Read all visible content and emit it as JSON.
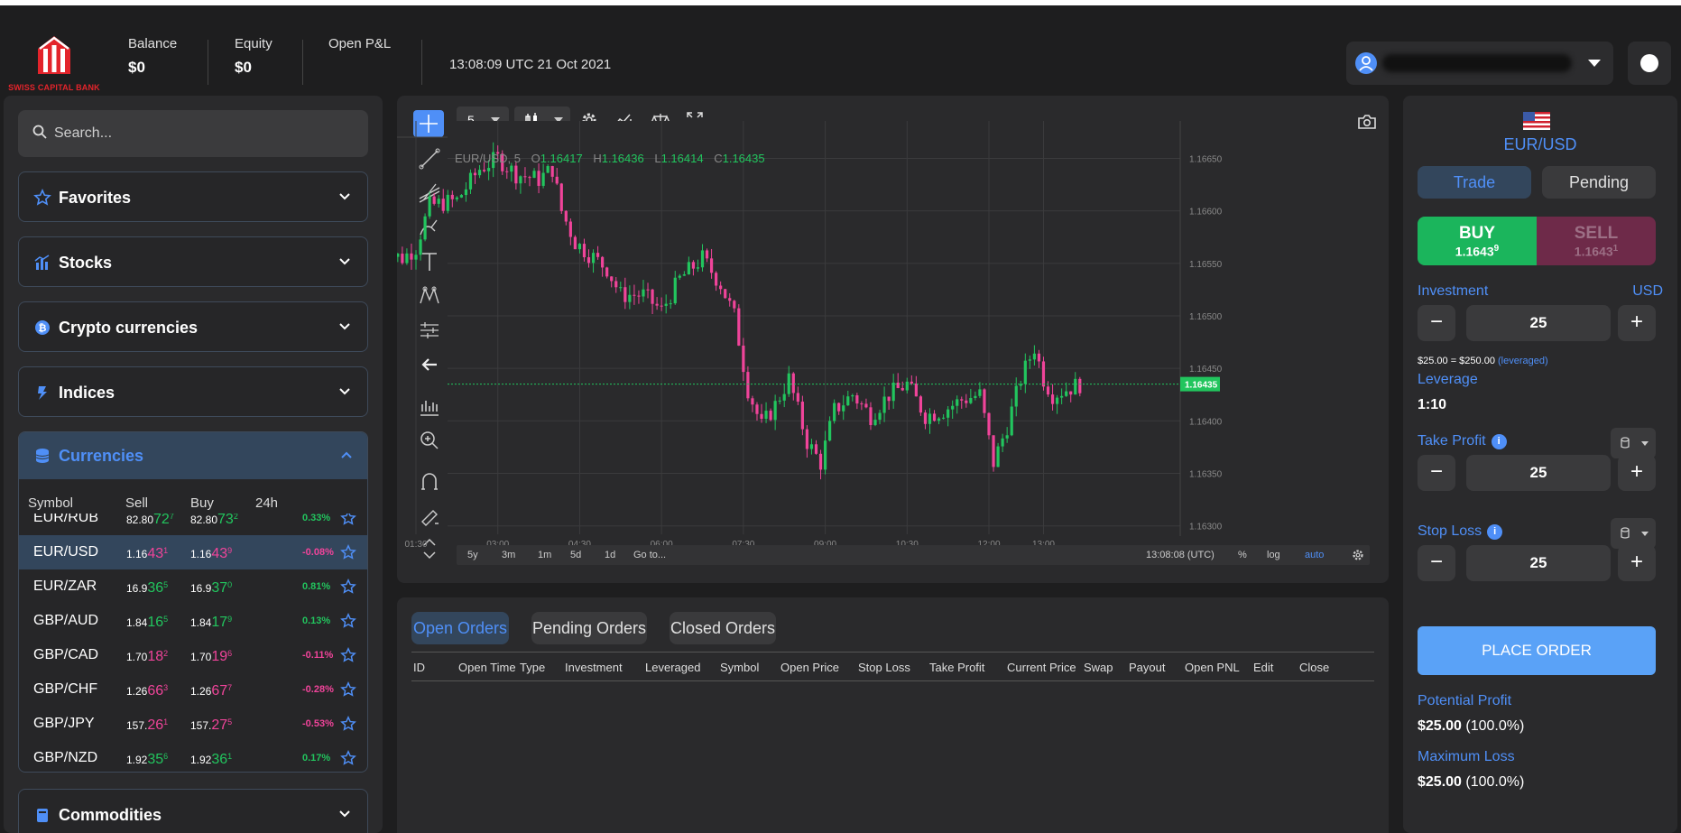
{
  "brand": {
    "name": "SWISS CAPITAL BANK"
  },
  "header": {
    "balance_label": "Balance",
    "balance_value": "$0",
    "equity_label": "Equity",
    "equity_value": "$0",
    "pnl_label": "Open P&L",
    "clock": "13:08:09 UTC 21 Oct 2021"
  },
  "sidebar": {
    "search_placeholder": "Search...",
    "categories": [
      {
        "label": "Favorites",
        "icon": "star-icon"
      },
      {
        "label": "Stocks",
        "icon": "bar-chart-icon"
      },
      {
        "label": "Crypto currencies",
        "icon": "bitcoin-icon"
      },
      {
        "label": "Indices",
        "icon": "indices-icon"
      },
      {
        "label": "Currencies",
        "icon": "coins-icon"
      },
      {
        "label": "Commodities",
        "icon": "oil-icon"
      }
    ],
    "columns": {
      "symbol": "Symbol",
      "sell": "Sell",
      "buy": "Buy",
      "change": "24h"
    },
    "rows": [
      {
        "symbol": "EUR/RUB",
        "sell_a": "82.80",
        "sell_b": "72",
        "sell_c": "7",
        "buy_a": "82.80",
        "buy_b": "73",
        "buy_c": "2",
        "change": "0.33%",
        "dir": "up"
      },
      {
        "symbol": "EUR/USD",
        "sell_a": "1.16",
        "sell_b": "43",
        "sell_c": "1",
        "buy_a": "1.16",
        "buy_b": "43",
        "buy_c": "9",
        "change": "-0.08%",
        "dir": "down"
      },
      {
        "symbol": "EUR/ZAR",
        "sell_a": "16.9",
        "sell_b": "36",
        "sell_c": "5",
        "buy_a": "16.9",
        "buy_b": "37",
        "buy_c": "0",
        "change": "0.81%",
        "dir": "up"
      },
      {
        "symbol": "GBP/AUD",
        "sell_a": "1.84",
        "sell_b": "16",
        "sell_c": "5",
        "buy_a": "1.84",
        "buy_b": "17",
        "buy_c": "9",
        "change": "0.13%",
        "dir": "up"
      },
      {
        "symbol": "GBP/CAD",
        "sell_a": "1.70",
        "sell_b": "18",
        "sell_c": "2",
        "buy_a": "1.70",
        "buy_b": "19",
        "buy_c": "6",
        "change": "-0.11%",
        "dir": "down"
      },
      {
        "symbol": "GBP/CHF",
        "sell_a": "1.26",
        "sell_b": "66",
        "sell_c": "3",
        "buy_a": "1.26",
        "buy_b": "67",
        "buy_c": "7",
        "change": "-0.28%",
        "dir": "down"
      },
      {
        "symbol": "GBP/JPY",
        "sell_a": "157.",
        "sell_b": "26",
        "sell_c": "1",
        "buy_a": "157.",
        "buy_b": "27",
        "buy_c": "5",
        "change": "-0.53%",
        "dir": "down"
      },
      {
        "symbol": "GBP/NZD",
        "sell_a": "1.92",
        "sell_b": "35",
        "sell_c": "6",
        "buy_a": "1.92",
        "buy_b": "36",
        "buy_c": "1",
        "change": "0.17%",
        "dir": "up"
      }
    ]
  },
  "chart": {
    "interval": "5",
    "series_label": "EUR/USD, 5",
    "ohlc": {
      "o_label": "O",
      "o": "1.16417",
      "h_label": "H",
      "h": "1.16436",
      "l_label": "L",
      "l": "1.16414",
      "c_label": "C",
      "c": "1.16435"
    },
    "last_price": "1.16435",
    "ranges": [
      "5y",
      "3m",
      "1m",
      "5d",
      "1d",
      "Go to..."
    ],
    "time_readout": "13:08:08 (UTC)",
    "scale_options": [
      "%",
      "log",
      "auto"
    ],
    "colors": {
      "up": "#22c55e",
      "down": "#f0449a",
      "accent": "#4f8ff7"
    }
  },
  "chart_data": {
    "type": "candlestick",
    "title": "EUR/USD, 5",
    "x_ticks": [
      "01:30",
      "03:00",
      "04:30",
      "06:00",
      "07:30",
      "09:00",
      "10:30",
      "12:00",
      "13:00"
    ],
    "y_ticks": [
      "1.16650",
      "1.16600",
      "1.16550",
      "1.16500",
      "1.16450",
      "1.16400",
      "1.16350",
      "1.16300"
    ],
    "ylim": [
      1.16292,
      1.16665
    ],
    "close_path": [
      [
        "00:50",
        1.16562
      ],
      [
        "01:15",
        1.16555
      ],
      [
        "01:30",
        1.16565
      ],
      [
        "01:45",
        1.16605
      ],
      [
        "02:15",
        1.1661
      ],
      [
        "02:40",
        1.1664
      ],
      [
        "03:00",
        1.1665
      ],
      [
        "03:20",
        1.16635
      ],
      [
        "03:45",
        1.1663
      ],
      [
        "04:00",
        1.1664
      ],
      [
        "04:10",
        1.166
      ],
      [
        "04:25",
        1.1657
      ],
      [
        "05:00",
        1.16545
      ],
      [
        "05:15",
        1.1652
      ],
      [
        "05:40",
        1.1652
      ],
      [
        "06:00",
        1.16505
      ],
      [
        "06:20",
        1.16535
      ],
      [
        "06:45",
        1.16555
      ],
      [
        "07:05",
        1.1653
      ],
      [
        "07:20",
        1.165
      ],
      [
        "07:35",
        1.1643
      ],
      [
        "07:50",
        1.16395
      ],
      [
        "08:05",
        1.16415
      ],
      [
        "08:20",
        1.1644
      ],
      [
        "08:40",
        1.1638
      ],
      [
        "08:55",
        1.1636
      ],
      [
        "09:10",
        1.1641
      ],
      [
        "09:30",
        1.16425
      ],
      [
        "09:50",
        1.16405
      ],
      [
        "10:10",
        1.16425
      ],
      [
        "10:30",
        1.16435
      ],
      [
        "10:50",
        1.16405
      ],
      [
        "11:10",
        1.1641
      ],
      [
        "11:30",
        1.1642
      ],
      [
        "11:50",
        1.16425
      ],
      [
        "12:05",
        1.1636
      ],
      [
        "12:20",
        1.16395
      ],
      [
        "12:35",
        1.1644
      ],
      [
        "12:50",
        1.1647
      ],
      [
        "13:00",
        1.1644
      ],
      [
        "13:10",
        1.16425
      ],
      [
        "13:25",
        1.1643
      ],
      [
        "13:40",
        1.16435
      ]
    ],
    "up_color": "#22c55e",
    "down_color": "#f0449a",
    "grid": true
  },
  "orders": {
    "tabs": [
      "Open Orders",
      "Pending Orders",
      "Closed Orders"
    ],
    "columns": [
      "ID",
      "Open Time",
      "Type",
      "Investment",
      "Leveraged",
      "Symbol",
      "Open Price",
      "Stop Loss",
      "Take Profit",
      "Current Price",
      "Swap",
      "Payout",
      "Open PNL",
      "Edit",
      "Close"
    ]
  },
  "trade": {
    "pair": "EUR/USD",
    "tabs": [
      "Trade",
      "Pending"
    ],
    "buy_label": "BUY",
    "buy_price": "1.1643",
    "buy_sup": "9",
    "sell_label": "SELL",
    "sell_price": "1.1643",
    "sell_sup": "1",
    "investment_label": "Investment",
    "currency": "USD",
    "investment_value": "25",
    "leverage_range": "$25.00 = $250.00",
    "leverage_note": "(leveraged)",
    "leverage_label": "Leverage",
    "leverage_value": "1:10",
    "take_profit_label": "Take Profit",
    "take_profit_value": "25",
    "stop_loss_label": "Stop Loss",
    "stop_loss_value": "25",
    "place_order": "PLACE ORDER",
    "potential_profit_label": "Potential Profit",
    "potential_profit_value": "$25.00",
    "potential_profit_pct": "(100.0%)",
    "max_loss_label": "Maximum Loss",
    "max_loss_value": "$25.00",
    "max_loss_pct": "(100.0%)"
  }
}
